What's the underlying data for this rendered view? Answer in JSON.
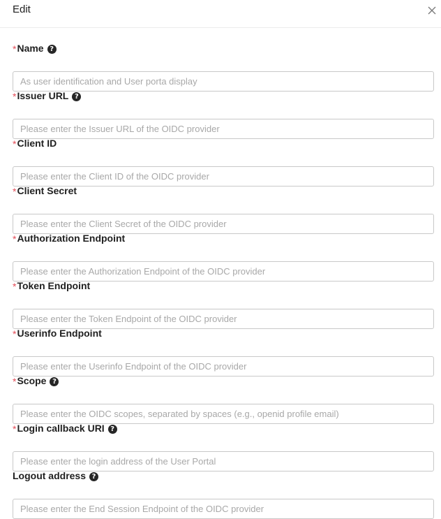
{
  "dialog": {
    "title": "Edit",
    "close_icon": "close-icon"
  },
  "fields": [
    {
      "label": "Name",
      "required": true,
      "help": true,
      "value": "",
      "placeholder": "As user identification and User porta display"
    },
    {
      "label": "Issuer URL",
      "required": true,
      "help": true,
      "value": "",
      "placeholder": "Please enter the Issuer URL of the OIDC provider"
    },
    {
      "label": "Client ID",
      "required": true,
      "help": false,
      "value": "",
      "placeholder": "Please enter the Client ID of the OIDC provider"
    },
    {
      "label": "Client Secret",
      "required": true,
      "help": false,
      "value": "",
      "placeholder": "Please enter the Client Secret of the OIDC provider"
    },
    {
      "label": "Authorization Endpoint",
      "required": true,
      "help": false,
      "value": "",
      "placeholder": "Please enter the Authorization Endpoint of the OIDC provider"
    },
    {
      "label": "Token Endpoint",
      "required": true,
      "help": false,
      "value": "",
      "placeholder": "Please enter the Token Endpoint of the OIDC provider"
    },
    {
      "label": "Userinfo Endpoint",
      "required": true,
      "help": false,
      "value": "",
      "placeholder": "Please enter the Userinfo Endpoint of the OIDC provider"
    },
    {
      "label": "Scope",
      "required": true,
      "help": true,
      "value": "",
      "placeholder": "Please enter the OIDC scopes, separated by spaces (e.g., openid profile email)"
    },
    {
      "label": "Login callback URI",
      "required": true,
      "help": true,
      "value": "",
      "placeholder": "Please enter the login address of the User Portal"
    },
    {
      "label": "Logout address",
      "required": false,
      "help": true,
      "value": "",
      "placeholder": "Please enter the End Session Endpoint of the OIDC provider"
    }
  ],
  "colors": {
    "required_marker": "#e34d59",
    "input_border": "#c8c8c8",
    "placeholder": "#a8a8a8",
    "help_icon": "#262626"
  },
  "required_marker": "*",
  "help_icon": "question-circle-icon"
}
